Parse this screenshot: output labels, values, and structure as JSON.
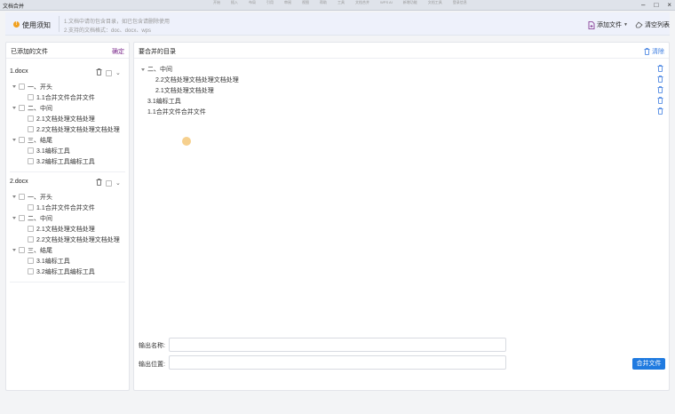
{
  "window": {
    "title": "文档合并",
    "bg_menu": [
      "开始",
      "插入",
      "布局",
      "引用",
      "审阅",
      "视图",
      "帮助",
      "工具",
      "文档合并",
      "WPS AI",
      "新增功能",
      "文档工具",
      "登录信息"
    ],
    "controls": [
      "–",
      "□",
      "×"
    ]
  },
  "notice": {
    "title": "使用须知",
    "line1": "1.文档中请勿包含目录，如已包含请删除使用",
    "line2": "2.支持的文档格式：doc、docx、wps"
  },
  "toolbar": {
    "add_file": "添加文件",
    "clear_list": "清空列表"
  },
  "left_panel": {
    "title": "已添加的文件",
    "confirm": "确定",
    "files": [
      {
        "name": "1.docx",
        "tree": [
          {
            "label": "一、开头",
            "level": 0,
            "expandable": true
          },
          {
            "label": "1.1合并文件合并文件",
            "level": 1,
            "expandable": false
          },
          {
            "label": "二、中间",
            "level": 0,
            "expandable": true
          },
          {
            "label": "2.1文档处理文档处理",
            "level": 1,
            "expandable": false
          },
          {
            "label": "2.2文档处理文档处理文档处理",
            "level": 1,
            "expandable": false
          },
          {
            "label": "三、结尾",
            "level": 0,
            "expandable": true
          },
          {
            "label": "3.1编标工具",
            "level": 1,
            "expandable": false
          },
          {
            "label": "3.2编标工具编标工具",
            "level": 1,
            "expandable": false
          }
        ]
      },
      {
        "name": "2.docx",
        "tree": [
          {
            "label": "一、开头",
            "level": 0,
            "expandable": true
          },
          {
            "label": "1.1合并文件合并文件",
            "level": 1,
            "expandable": false
          },
          {
            "label": "二、中间",
            "level": 0,
            "expandable": true
          },
          {
            "label": "2.1文档处理文档处理",
            "level": 1,
            "expandable": false
          },
          {
            "label": "2.2文档处理文档处理文档处理",
            "level": 1,
            "expandable": false
          },
          {
            "label": "三、结尾",
            "level": 0,
            "expandable": true
          },
          {
            "label": "3.1编标工具",
            "level": 1,
            "expandable": false
          },
          {
            "label": "3.2编标工具编标工具",
            "level": 1,
            "expandable": false
          }
        ]
      }
    ]
  },
  "right_panel": {
    "title": "要合并的目录",
    "clear": "清除",
    "tree": [
      {
        "label": "二、中间",
        "level": 0,
        "expandable": true
      },
      {
        "label": "2.2文档处理文档处理文档处理",
        "level": 1,
        "expandable": false
      },
      {
        "label": "2.1文档处理文档处理",
        "level": 1,
        "expandable": false
      },
      {
        "label": "3.1编标工具",
        "level": 2,
        "expandable": false
      },
      {
        "label": "1.1合并文件合并文件",
        "level": 2,
        "expandable": false
      }
    ],
    "output_name_label": "输出名称:",
    "output_name_value": "",
    "output_path_label": "输出位置:",
    "output_path_value": "",
    "merge_button": "合并文件"
  },
  "colors": {
    "primary": "#1f7ae0",
    "confirm": "#7b2a8c",
    "warn": "#f0a020"
  }
}
